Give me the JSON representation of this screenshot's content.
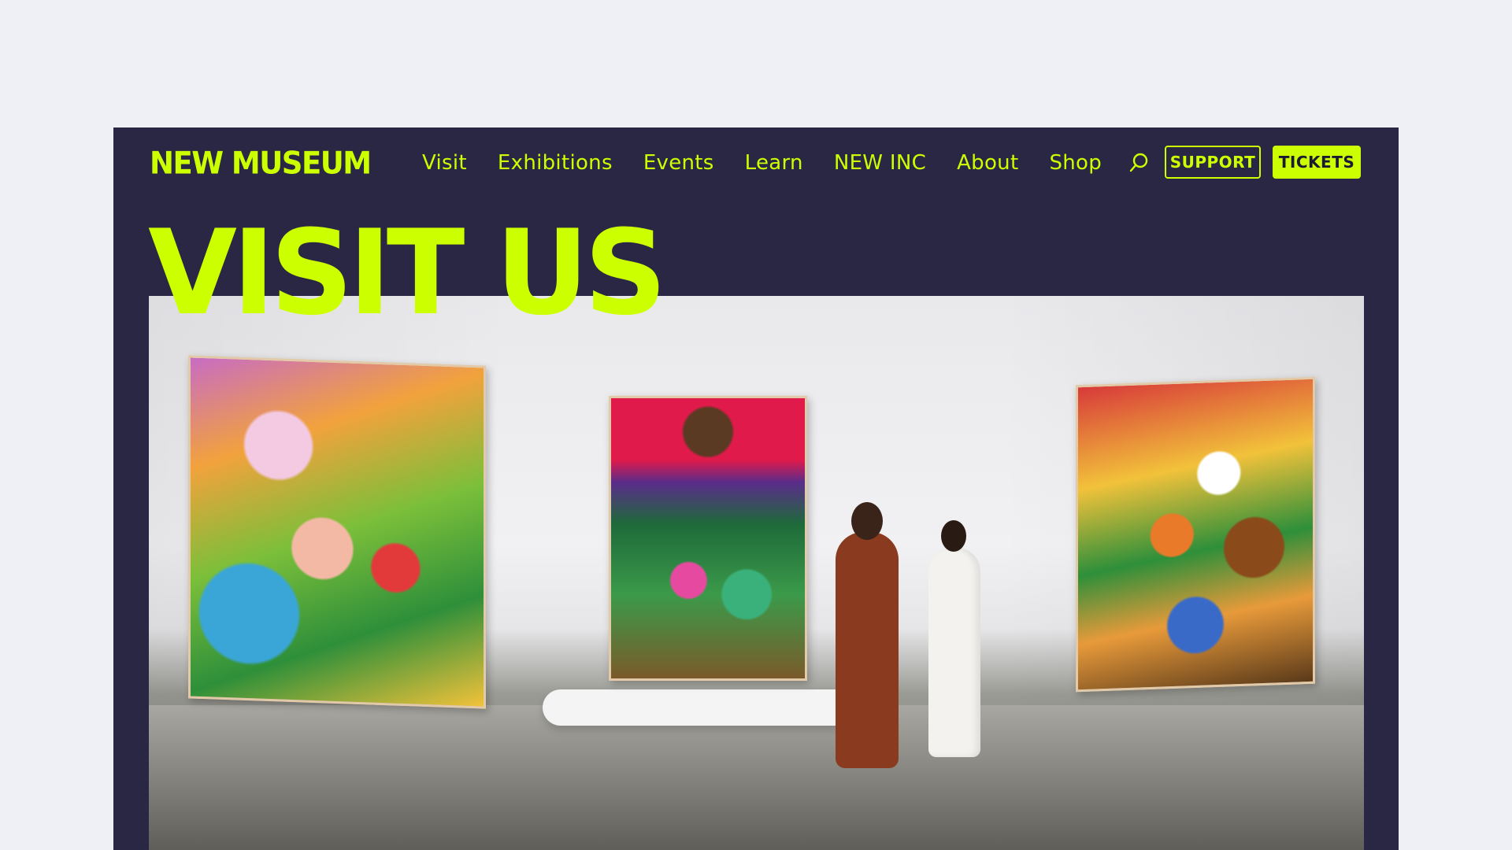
{
  "header": {
    "logo": "NEW MUSEUM",
    "nav": [
      "Visit",
      "Exhibitions",
      "Events",
      "Learn",
      "NEW INC",
      "About",
      "Shop"
    ],
    "search_icon": "search-icon",
    "support_label": "SUPPORT",
    "tickets_label": "TICKETS"
  },
  "hero": {
    "title": "VISIT US"
  },
  "colors": {
    "background": "#2a2744",
    "accent": "#ccff00",
    "page": "#eef0f5"
  }
}
